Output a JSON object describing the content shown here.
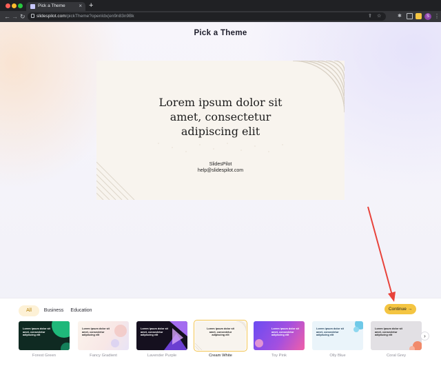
{
  "browser": {
    "tab_title": "Pick a Theme",
    "tab_close": "×",
    "new_tab": "+",
    "url_domain": "slidespilot.com",
    "url_path": "/pickTheme?openIdx(en9n83n9Bk",
    "avatar_letter": "S",
    "menu_icon": "⋮",
    "back_icon": "←",
    "forward_icon": "→",
    "reload_icon": "↻",
    "share_icon": "⇪",
    "star_icon": "☆",
    "extensions_icon": "✱"
  },
  "page": {
    "title": "Pick a Theme"
  },
  "preview": {
    "heading_line1": "Lorem ipsum dolor sit",
    "heading_line2": "amet, consectetur",
    "heading_line3": "adipiscing elit",
    "brand": "SlidesPilot",
    "email": "help@slidespilot.com"
  },
  "categories": [
    {
      "label": "All",
      "active": true
    },
    {
      "label": "Business",
      "active": false
    },
    {
      "label": "Education",
      "active": false
    }
  ],
  "continue_label": "Continue →",
  "next_icon": "›",
  "themes": [
    {
      "label": "Forest Green",
      "text": "Lorem ipsum dolor sit amet, consectetur adipiscing elit",
      "bg": "#0f2a22",
      "accent": "#1fb87a",
      "fg": "#ffffff",
      "selected": false
    },
    {
      "label": "Fancy Gradient",
      "text": "Lorem ipsum dolor sit amet, consectetur adipiscing elit",
      "bg": "#f6efe8",
      "accent": "#f3b6b0",
      "fg": "#222222",
      "selected": false
    },
    {
      "label": "Lavender Purple",
      "text": "Lorem ipsum dolor sit amet, consectetur adipiscing elit",
      "bg": "#15101f",
      "accent": "#7d4fd6",
      "fg": "#ffffff",
      "selected": false
    },
    {
      "label": "Cream White",
      "text": "Lorem ipsum dolor sit amet, consectetur adipiscing elit",
      "bg": "#f8f4ee",
      "accent": "#e8dccb",
      "fg": "#222222",
      "selected": true
    },
    {
      "label": "Toy Pink",
      "text": "Lorem ipsum dolor sit amet, consectetur adipiscing elit",
      "bg": "#6b4cf2",
      "accent": "#f05fa8",
      "fg": "#ffffff",
      "selected": false
    },
    {
      "label": "Olly Blue",
      "text": "Lorem ipsum dolor sit amet, consectetur adipiscing elit",
      "bg": "#eaf4fa",
      "accent": "#3ab6df",
      "fg": "#1a3a55",
      "selected": false
    },
    {
      "label": "Coral Grey",
      "text": "Lorem ipsum dolor sit amet, consectetur adipiscing elit",
      "bg": "#e2e0e4",
      "accent": "#f18a6a",
      "fg": "#222222",
      "selected": false
    }
  ],
  "colors": {
    "accent_yellow": "#f4c542",
    "annotation_red": "#e8423a"
  }
}
